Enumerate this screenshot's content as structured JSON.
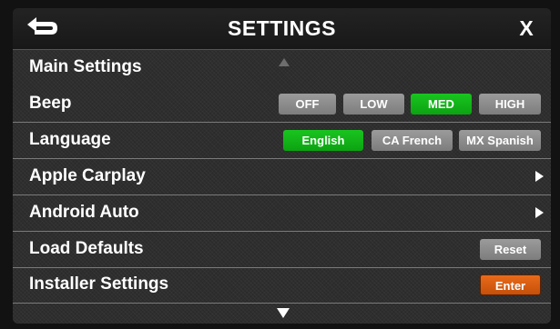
{
  "header": {
    "title": "SETTINGS",
    "close_label": "X",
    "back_icon": "back-arrow-icon"
  },
  "rows": {
    "main_settings": {
      "label": "Main Settings"
    },
    "beep": {
      "label": "Beep",
      "options": [
        "OFF",
        "LOW",
        "MED",
        "HIGH"
      ],
      "selected": "MED"
    },
    "language": {
      "label": "Language",
      "options": [
        "English",
        "CA French",
        "MX Spanish"
      ],
      "selected": "English"
    },
    "apple_carplay": {
      "label": "Apple Carplay"
    },
    "android_auto": {
      "label": "Android Auto"
    },
    "load_defaults": {
      "label": "Load Defaults",
      "button": "Reset"
    },
    "installer_settings": {
      "label": "Installer Settings",
      "button": "Enter"
    }
  },
  "colors": {
    "active": "#12b518",
    "inactive": "#8a8a8a",
    "warning": "#d85f10",
    "background": "#2b2b2b"
  }
}
